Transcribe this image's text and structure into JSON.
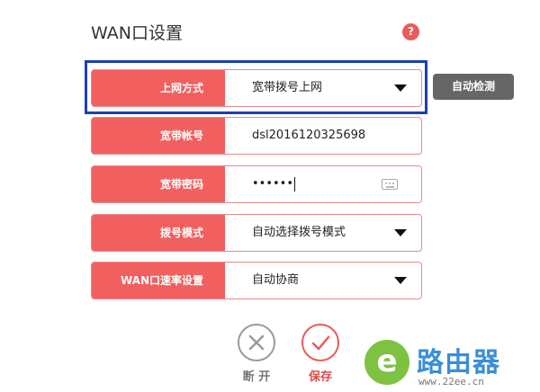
{
  "page": {
    "title": "WAN口设置",
    "help_symbol": "?"
  },
  "form": {
    "connection_type": {
      "label": "上网方式",
      "value": "宽带拨号上网"
    },
    "account": {
      "label": "宽带帐号",
      "value": "dsl2016120325698"
    },
    "password": {
      "label": "宽带密码",
      "value": "••••••"
    },
    "dial_mode": {
      "label": "拨号模式",
      "value": "自动选择拨号模式"
    },
    "wan_speed": {
      "label": "WAN口速率设置",
      "value": "自动协商"
    }
  },
  "buttons": {
    "auto_detect": "自动检测",
    "disconnect": "断 开",
    "save": "保存"
  },
  "watermark": {
    "badge": "e",
    "brand": "路由器",
    "url": "www.22ee.cn"
  },
  "colors": {
    "accent": "#f25f5f",
    "highlight": "#1a3fb8",
    "detect_button": "#666666"
  }
}
